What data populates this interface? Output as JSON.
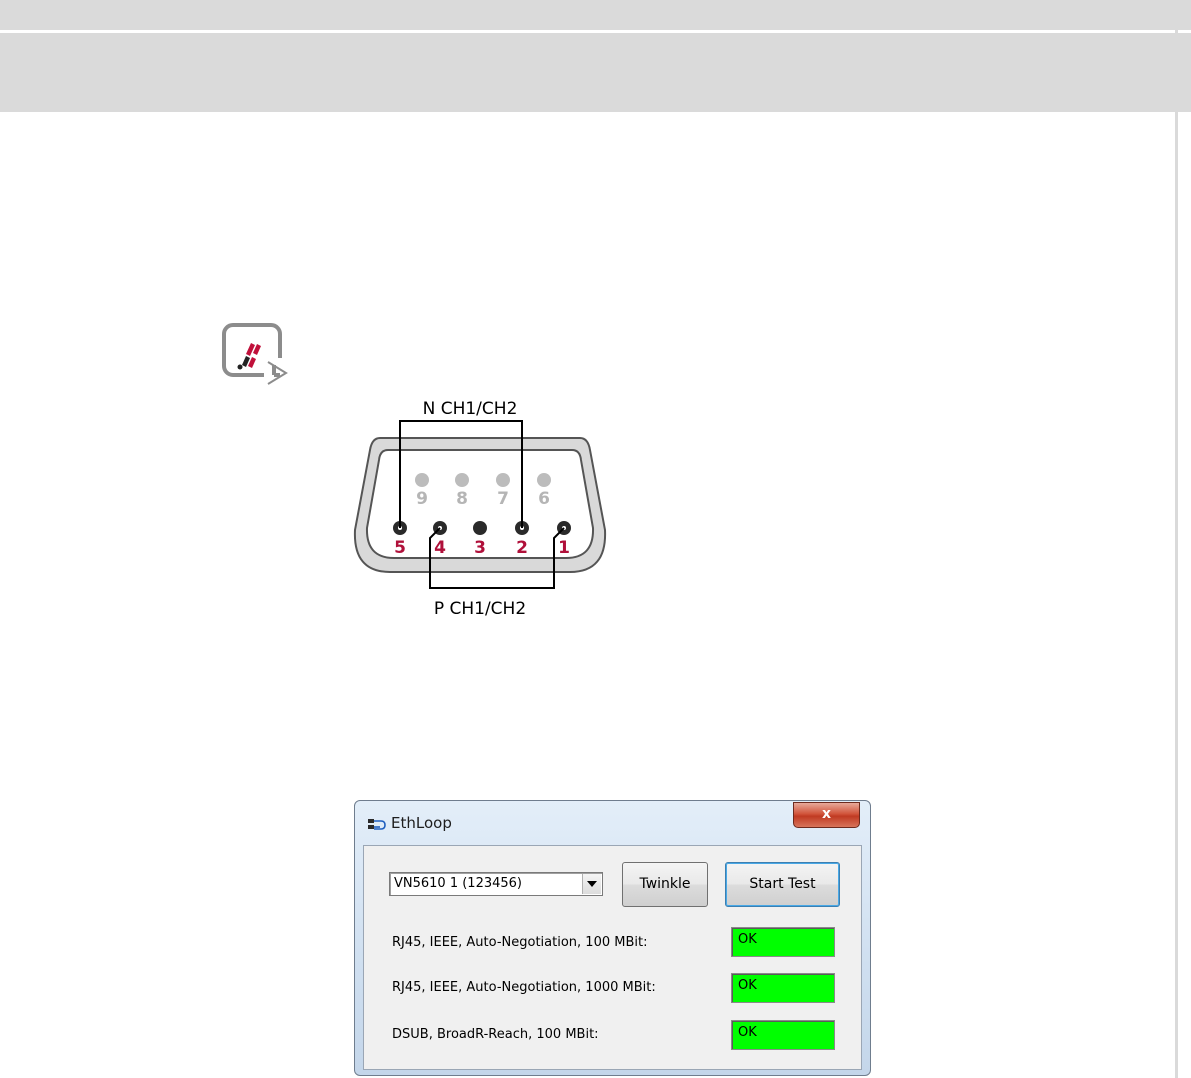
{
  "connector": {
    "top_label": "N CH1/CH2",
    "bottom_label": "P CH1/CH2",
    "pins_top": [
      "9",
      "8",
      "7",
      "6"
    ],
    "pins_bottom": [
      "5",
      "4",
      "3",
      "2",
      "1"
    ],
    "colors": {
      "active_pin_label": "#b0103a",
      "inactive_pin": "#b5b5b5",
      "pin_dark": "#2a2a2a"
    }
  },
  "dialog": {
    "title": "EthLoop",
    "close_label": "x",
    "device_select": {
      "value": "VN5610 1 (123456)"
    },
    "buttons": {
      "twinkle": "Twinkle",
      "start_test": "Start Test"
    },
    "rows": [
      {
        "label": "RJ45, IEEE, Auto-Negotiation, 100 MBit:",
        "status": "OK"
      },
      {
        "label": "RJ45, IEEE, Auto-Negotiation, 1000 MBit:",
        "status": "OK"
      },
      {
        "label": "DSUB, BroadR-Reach, 100 MBit:",
        "status": "OK"
      }
    ],
    "colors": {
      "status_ok": "#00ff00"
    }
  },
  "icons": [
    "connector-note-icon",
    "ethloop-app-icon",
    "close-icon",
    "dropdown-arrow-icon"
  ]
}
